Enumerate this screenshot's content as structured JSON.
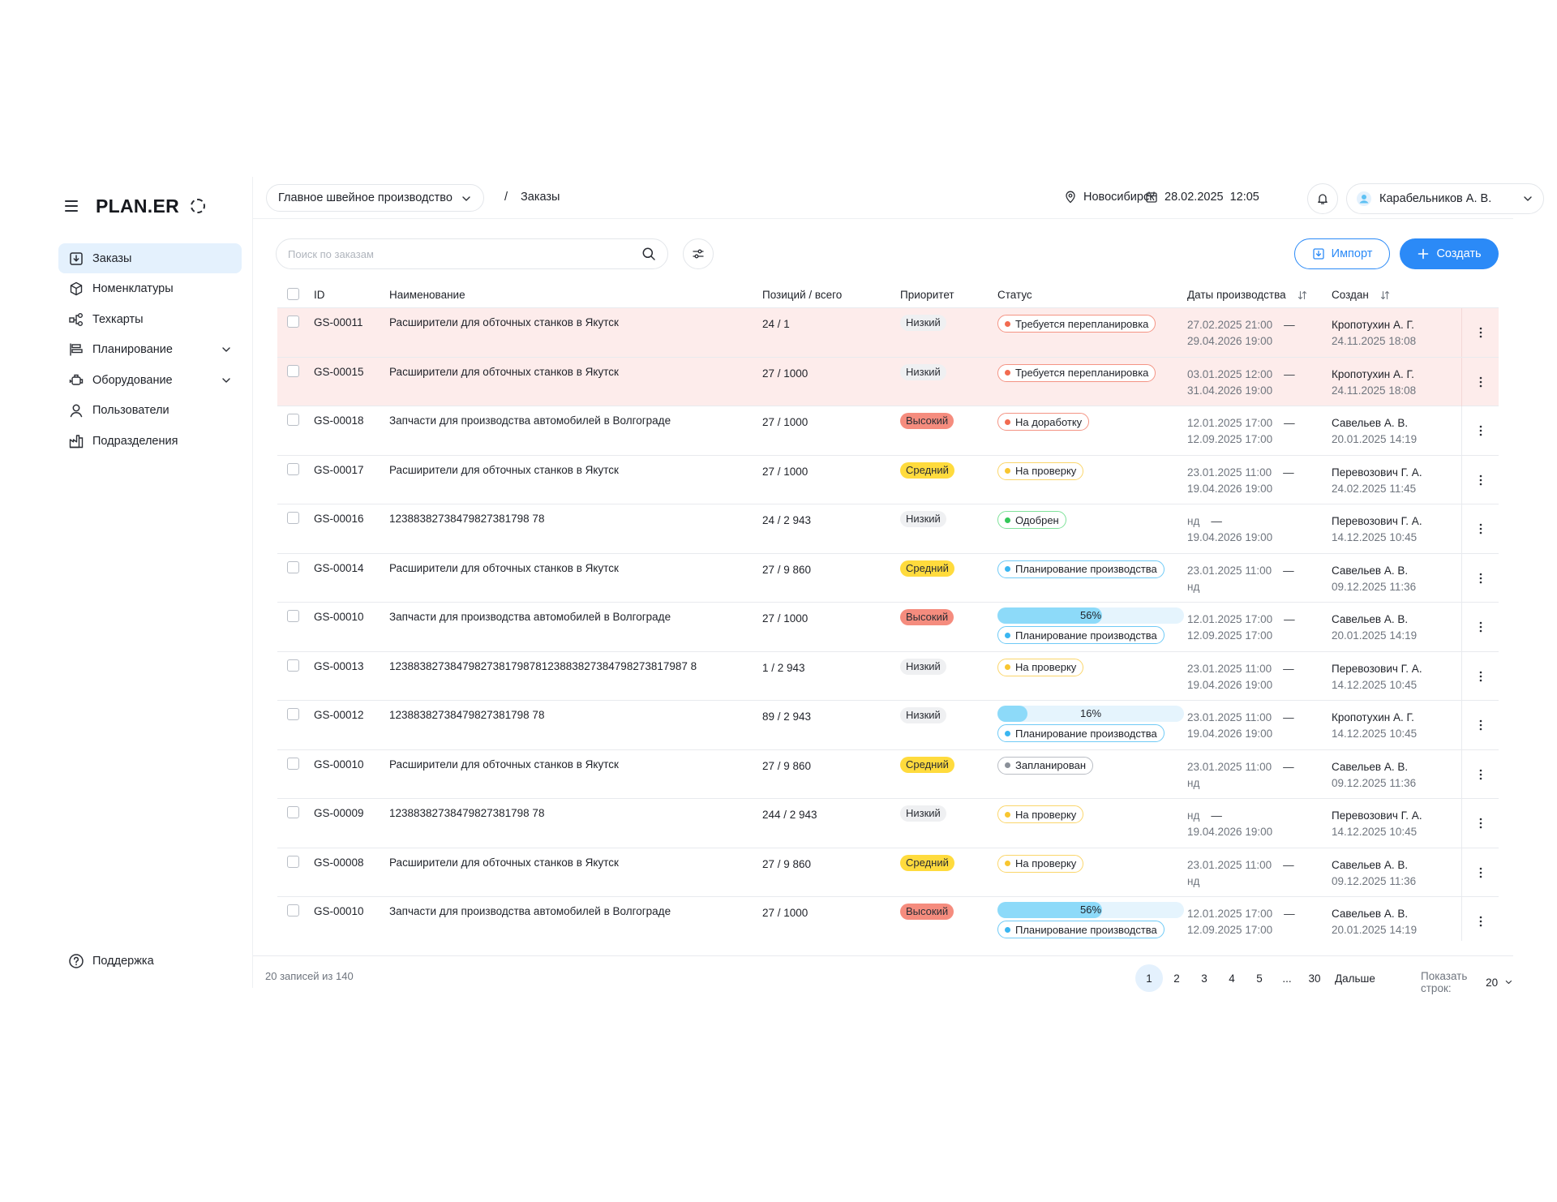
{
  "app": {
    "logo": "PLAN.ER"
  },
  "sidebar": {
    "items": [
      {
        "label": "Заказы",
        "icon": "download-box-icon",
        "active": true,
        "expandable": false
      },
      {
        "label": "Номенклатуры",
        "icon": "cube-icon",
        "active": false,
        "expandable": false
      },
      {
        "label": "Техкарты",
        "icon": "flow-icon",
        "active": false,
        "expandable": false
      },
      {
        "label": "Планирование",
        "icon": "gantt-icon",
        "active": false,
        "expandable": true
      },
      {
        "label": "Оборудование",
        "icon": "engine-icon",
        "active": false,
        "expandable": true
      },
      {
        "label": "Пользователи",
        "icon": "user-icon",
        "active": false,
        "expandable": false
      },
      {
        "label": "Подразделения",
        "icon": "factory-icon",
        "active": false,
        "expandable": false
      }
    ],
    "support": "Поддержка"
  },
  "header": {
    "production": "Главное швейное производство",
    "separator": "/",
    "current": "Заказы",
    "city": "Новосибирск",
    "date": "28.02.2025",
    "time": "12:05",
    "user": "Карабельников А. В."
  },
  "toolbar": {
    "search_placeholder": "Поиск по заказам",
    "import_label": "Импорт",
    "create_label": "Создать"
  },
  "table": {
    "columns": {
      "id": "ID",
      "name": "Наименование",
      "positions": "Позиций / всего",
      "priority": "Приоритет",
      "status": "Статус",
      "dates": "Даты производства",
      "created": "Создан"
    },
    "rows": [
      {
        "id": "GS-00011",
        "name": "Расширители для обточных станков в Якутск",
        "positions": "24 / 1",
        "priority": "Низкий",
        "priority_level": "low",
        "status": "Требуется перепланировка",
        "status_color": "red",
        "progress": null,
        "date_start": "27.02.2025  21:00",
        "date_end": "29.04.2026  19:00",
        "author": "Кропотухин А. Г.",
        "created_at": "24.11.2025  18:08",
        "highlight": true
      },
      {
        "id": "GS-00015",
        "name": "Расширители для обточных станков в Якутск",
        "positions": "27 / 1000",
        "priority": "Низкий",
        "priority_level": "low",
        "status": "Требуется перепланировка",
        "status_color": "red",
        "progress": null,
        "date_start": "03.01.2025  12:00",
        "date_end": "31.04.2026  19:00",
        "author": "Кропотухин А. Г.",
        "created_at": "24.11.2025  18:08",
        "highlight": true
      },
      {
        "id": "GS-00018",
        "name": "Запчасти для производства автомобилей в Волгограде",
        "positions": "27 / 1000",
        "priority": "Высокий",
        "priority_level": "high",
        "status": "На доработку",
        "status_color": "red",
        "progress": null,
        "date_start": "12.01.2025  17:00",
        "date_end": "12.09.2025  17:00",
        "author": "Савельев А. В.",
        "created_at": "20.01.2025  14:19",
        "highlight": false
      },
      {
        "id": "GS-00017",
        "name": "Расширители для обточных станков в Якутск",
        "positions": "27 / 1000",
        "priority": "Средний",
        "priority_level": "mid",
        "status": "На проверку",
        "status_color": "yellow",
        "progress": null,
        "date_start": "23.01.2025  11:00",
        "date_end": "19.04.2026  19:00",
        "author": "Перевозович Г. А.",
        "created_at": "24.02.2025  11:45",
        "highlight": false
      },
      {
        "id": "GS-00016",
        "name": "12388382738479827381798 78",
        "positions": "24 / 2 943",
        "priority": "Низкий",
        "priority_level": "low",
        "status": "Одобрен",
        "status_color": "green",
        "progress": null,
        "date_start": "нд",
        "date_end": "19.04.2026  19:00",
        "author": "Перевозович Г. А.",
        "created_at": "14.12.2025  10:45",
        "highlight": false
      },
      {
        "id": "GS-00014",
        "name": "Расширители для обточных станков в Якутск",
        "positions": "27 / 9 860",
        "priority": "Средний",
        "priority_level": "mid",
        "status": "Планирование производства",
        "status_color": "blue",
        "progress": null,
        "date_start": "23.01.2025  11:00",
        "date_end": "нд",
        "author": "Савельев А. В.",
        "created_at": "09.12.2025  11:36",
        "highlight": false
      },
      {
        "id": "GS-00010",
        "name": "Запчасти для производства автомобилей в Волгограде",
        "positions": "27 / 1000",
        "priority": "Высокий",
        "priority_level": "high",
        "status": "Планирование производства",
        "status_color": "blue",
        "progress": 56,
        "progress_label": "56%",
        "date_start": "12.01.2025  17:00",
        "date_end": "12.09.2025  17:00",
        "author": "Савельев А. В.",
        "created_at": "20.01.2025  14:19",
        "highlight": false
      },
      {
        "id": "GS-00013",
        "name": "1238838273847982738179878123883827384798273817987 8",
        "positions": "1 / 2 943",
        "priority": "Низкий",
        "priority_level": "low",
        "status": "На проверку",
        "status_color": "yellow",
        "progress": null,
        "date_start": "23.01.2025  11:00",
        "date_end": "19.04.2026  19:00",
        "author": "Перевозович Г. А.",
        "created_at": "14.12.2025  10:45",
        "highlight": false
      },
      {
        "id": "GS-00012",
        "name": "12388382738479827381798 78",
        "positions": "89 / 2 943",
        "priority": "Низкий",
        "priority_level": "low",
        "status": "Планирование производства",
        "status_color": "blue",
        "progress": 16,
        "progress_label": "16%",
        "date_start": "23.01.2025  11:00",
        "date_end": "19.04.2026  19:00",
        "author": "Кропотухин А. Г.",
        "created_at": "14.12.2025  10:45",
        "highlight": false
      },
      {
        "id": "GS-00010",
        "name": "Расширители для обточных станков в Якутск",
        "positions": "27 / 9 860",
        "priority": "Средний",
        "priority_level": "mid",
        "status": "Запланирован",
        "status_color": "gray",
        "progress": null,
        "date_start": "23.01.2025  11:00",
        "date_end": "нд",
        "author": "Савельев А. В.",
        "created_at": "09.12.2025  11:36",
        "highlight": false
      },
      {
        "id": "GS-00009",
        "name": "12388382738479827381798 78",
        "positions": "244 / 2 943",
        "priority": "Низкий",
        "priority_level": "low",
        "status": "На проверку",
        "status_color": "yellow",
        "progress": null,
        "date_start": "нд",
        "date_end": "19.04.2026  19:00",
        "author": "Перевозович Г. А.",
        "created_at": "14.12.2025  10:45",
        "highlight": false
      },
      {
        "id": "GS-00008",
        "name": "Расширители для обточных станков в Якутск",
        "positions": "27 / 9 860",
        "priority": "Средний",
        "priority_level": "mid",
        "status": "На проверку",
        "status_color": "yellow",
        "progress": null,
        "date_start": "23.01.2025  11:00",
        "date_end": "нд",
        "author": "Савельев А. В.",
        "created_at": "09.12.2025  11:36",
        "highlight": false
      },
      {
        "id": "GS-00010",
        "name": "Запчасти для производства автомобилей в Волгограде",
        "positions": "27 / 1000",
        "priority": "Высокий",
        "priority_level": "high",
        "status": "Планирование производства",
        "status_color": "blue",
        "progress": 56,
        "progress_label": "56%",
        "date_start": "12.01.2025  17:00",
        "date_end": "12.09.2025  17:00",
        "author": "Савельев А. В.",
        "created_at": "20.01.2025  14:19",
        "highlight": false
      }
    ]
  },
  "footer": {
    "count": "20 записей из 140",
    "pages": [
      "1",
      "2",
      "3",
      "4",
      "5",
      "...",
      "30"
    ],
    "current_page": "1",
    "next_label": "Дальше",
    "rows_label": "Показать строк:",
    "rows_value": "20"
  },
  "colors": {
    "accent": "#2b8af7",
    "active_nav": "#e4f1fd",
    "warn_row": "#fdeceb"
  }
}
